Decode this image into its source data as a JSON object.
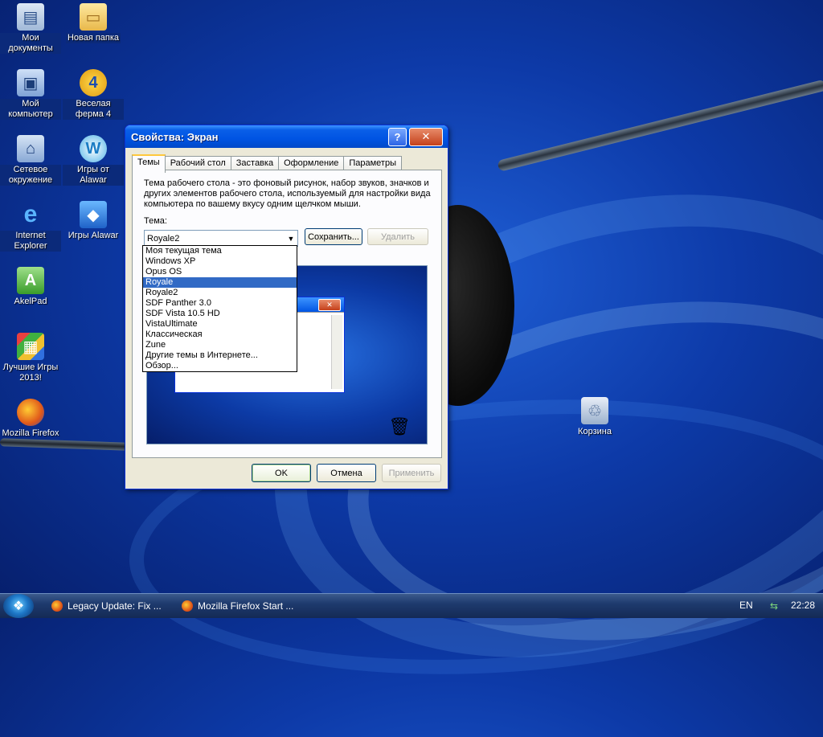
{
  "desktop": {
    "icons": [
      {
        "label": "Мои документы",
        "icon": "my-documents-icon"
      },
      {
        "label": "Новая папка",
        "icon": "folder-icon"
      },
      {
        "label": "Мой компьютер",
        "icon": "my-computer-icon"
      },
      {
        "label": "Веселая ферма 4",
        "icon": "farm-game-icon"
      },
      {
        "label": "Сетевое окружение",
        "icon": "network-icon"
      },
      {
        "label": "Игры от Alawar",
        "icon": "alawar-icon"
      },
      {
        "label": "Internet Explorer",
        "icon": "internet-explorer-icon"
      },
      {
        "label": "Игры Alawar",
        "icon": "alawar-games-icon"
      },
      {
        "label": "AkelPad",
        "icon": "akelpad-icon"
      },
      {
        "label": "Лучшие Игры 2013!",
        "icon": "best-games-icon"
      },
      {
        "label": "Mozilla Firefox",
        "icon": "firefox-icon"
      },
      {
        "label": "Корзина",
        "icon": "recycle-bin-icon"
      }
    ]
  },
  "dialog": {
    "title": "Свойства: Экран",
    "help_glyph": "?",
    "close_glyph": "✕",
    "tabs": [
      "Темы",
      "Рабочий стол",
      "Заставка",
      "Оформление",
      "Параметры"
    ],
    "active_tab": "Темы",
    "description": "Тема рабочего стола - это фоновый рисунок, набор звуков, значков и других элементов рабочего стола, используемый для настройки вида компьютера по вашему вкусу одним щелчком мыши.",
    "theme_label": "Тема:",
    "theme_value": "Royale2",
    "save_button": "Сохранить...",
    "delete_button": "Удалить",
    "dropdown_options": [
      "Моя текущая тема",
      "Windows XP",
      "Opus OS",
      "Royale",
      "Royale2",
      "SDF Panther 3.0",
      "SDF Vista 10.5 HD",
      "VistaUltimate",
      "Классическая",
      "Zune",
      "Другие темы в Интернете...",
      "Обзор..."
    ],
    "highlighted_option": "Royale",
    "ok_button": "OK",
    "cancel_button": "Отмена",
    "apply_button": "Применить"
  },
  "taskbar": {
    "tasks": [
      "Legacy Update: Fix ...",
      "Mozilla Firefox Start ..."
    ],
    "language": "EN",
    "clock": "22:28"
  },
  "colors": {
    "selection": "#316ac5",
    "titlebar": "#0054e3",
    "dialog_face": "#ece9d8"
  }
}
